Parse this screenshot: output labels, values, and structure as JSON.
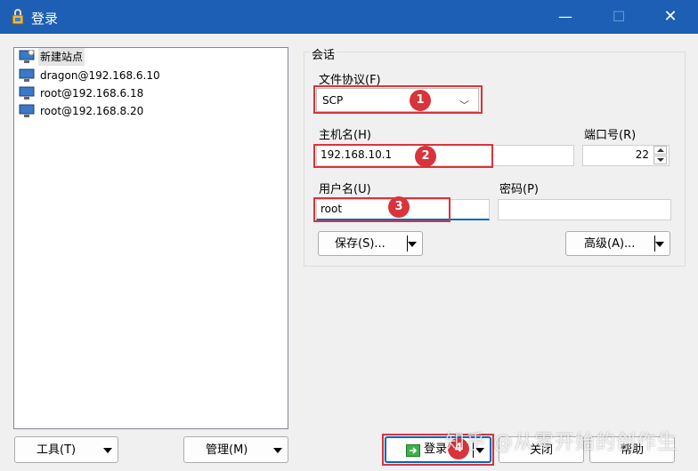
{
  "window": {
    "title": "登录",
    "minimize": "—",
    "maximize": "☐",
    "close": "✕"
  },
  "sites": [
    {
      "label": "新建站点",
      "selected": true
    },
    {
      "label": "dragon@192.168.6.10"
    },
    {
      "label": "root@192.168.6.18"
    },
    {
      "label": "root@192.168.8.20"
    }
  ],
  "session": {
    "group_title": "会话",
    "protocol_label": "文件协议(F)",
    "protocol_value": "SCP",
    "host_label": "主机名(H)",
    "host_value": "192.168.10.1",
    "port_label": "端口号(R)",
    "port_value": "22",
    "user_label": "用户名(U)",
    "user_value": "root",
    "password_label": "密码(P)",
    "password_value": "",
    "save_label": "保存(S)...",
    "advanced_label": "高级(A)..."
  },
  "bottom": {
    "tools_label": "工具(T)",
    "manage_label": "管理(M)",
    "login_label": "登录",
    "close_label": "关闭",
    "help_label": "帮助"
  },
  "markers": [
    "1",
    "2",
    "3",
    "4"
  ],
  "watermark": "知乎 @从零开始的创作生",
  "colors": {
    "titlebar": "#1c5fb4",
    "annotation_red": "#d9343b",
    "focus_blue": "#0067c0"
  }
}
